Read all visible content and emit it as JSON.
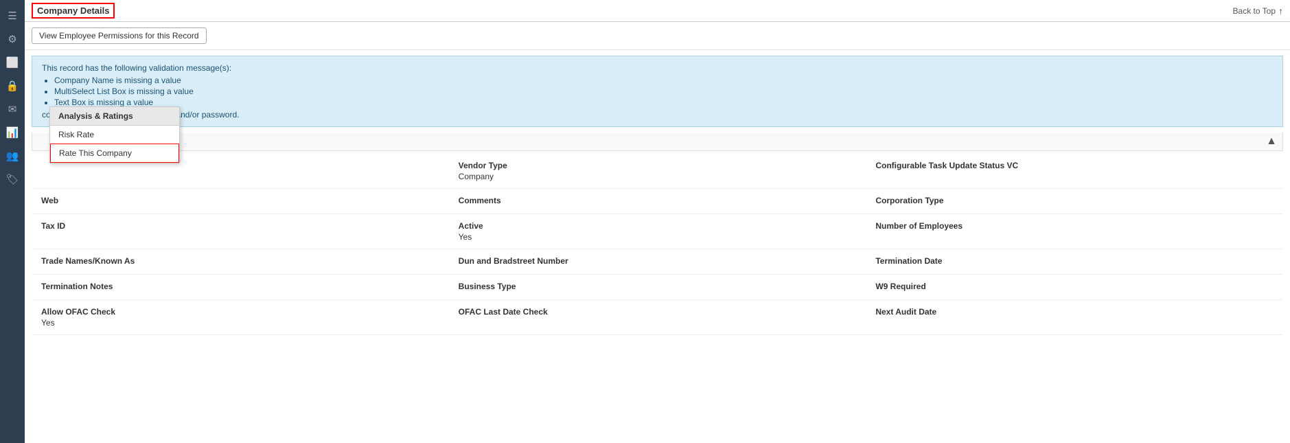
{
  "sidebar": {
    "icons": [
      {
        "name": "menu-icon",
        "symbol": "☰"
      },
      {
        "name": "settings-icon",
        "symbol": "⚙"
      },
      {
        "name": "document-icon",
        "symbol": "📄"
      },
      {
        "name": "lock-icon",
        "symbol": "🔒"
      },
      {
        "name": "mail-icon",
        "symbol": "✉"
      },
      {
        "name": "chart-icon",
        "symbol": "📊"
      },
      {
        "name": "people-icon",
        "symbol": "👥"
      },
      {
        "name": "tag-icon",
        "symbol": "🏷"
      }
    ]
  },
  "header": {
    "title": "Company Details",
    "back_to_top": "Back to Top"
  },
  "toolbar": {
    "permissions_btn": "View Employee Permissions for this Record"
  },
  "validation": {
    "header": "This record has the following validation message(s):",
    "messages": [
      "Company Name is missing a value",
      "MultiSelect List Box is missing a value",
      "Text Box is missing a value"
    ],
    "note": "contact(s) missing email, username, and/or password."
  },
  "dropdown": {
    "section_header": "Analysis & Ratings",
    "items": [
      {
        "label": "Risk Rate",
        "highlighted": false
      },
      {
        "label": "Rate This Company",
        "highlighted": true
      }
    ]
  },
  "section_bar": {
    "arrow": "▲"
  },
  "fields": [
    [
      {
        "label": "",
        "value": "",
        "empty": true
      },
      {
        "label": "Vendor Type",
        "value": "Company"
      },
      {
        "label": "Configurable Task Update Status VC",
        "value": ""
      }
    ],
    [
      {
        "label": "Web",
        "value": ""
      },
      {
        "label": "Comments",
        "value": ""
      },
      {
        "label": "Corporation Type",
        "value": ""
      }
    ],
    [
      {
        "label": "Tax ID",
        "value": ""
      },
      {
        "label": "Active",
        "value": "Yes"
      },
      {
        "label": "Number of Employees",
        "value": ""
      }
    ],
    [
      {
        "label": "Trade Names/Known As",
        "value": ""
      },
      {
        "label": "Dun and Bradstreet Number",
        "value": ""
      },
      {
        "label": "Termination Date",
        "value": ""
      }
    ],
    [
      {
        "label": "Termination Notes",
        "value": ""
      },
      {
        "label": "Business Type",
        "value": ""
      },
      {
        "label": "W9 Required",
        "value": ""
      }
    ],
    [
      {
        "label": "Allow OFAC Check",
        "value": "Yes"
      },
      {
        "label": "OFAC Last Date Check",
        "value": ""
      },
      {
        "label": "Next Audit Date",
        "value": ""
      }
    ]
  ]
}
